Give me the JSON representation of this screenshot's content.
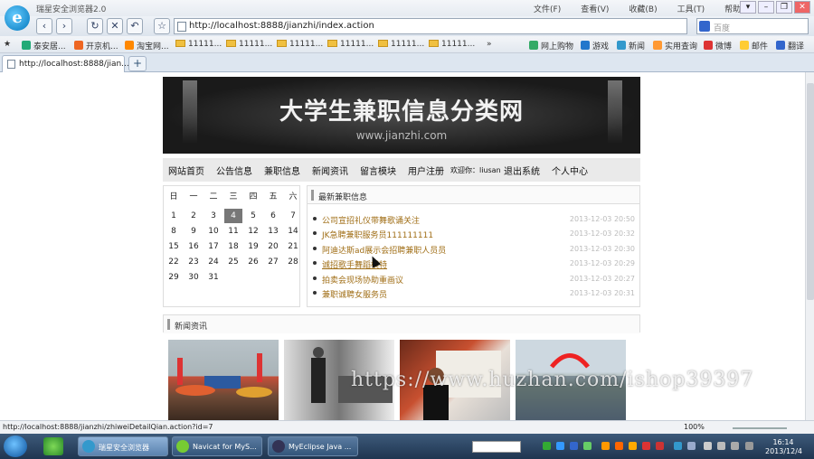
{
  "browser": {
    "title": "瑞星安全浏览器2.0",
    "menu": [
      "文件(F)",
      "查看(V)",
      "收藏(B)",
      "工具(T)",
      "帮助(H)"
    ],
    "address": "http://localhost:8888/jianzhi/index.action",
    "search_placeholder": "百度",
    "favorites": [
      "泰安居...",
      "开京机...",
      "淘宝网...",
      "11111...",
      "11111...",
      "11111...",
      "11111...",
      "11111...",
      "11111..."
    ],
    "favorites_right": [
      "网上购物",
      "游戏",
      "新闻",
      "实用查询",
      "微博",
      "邮件",
      "翻译"
    ],
    "more_chevron": "»",
    "tab_label": "http://localhost:8888/jian...",
    "new_tab": "+"
  },
  "page": {
    "banner_title": "大学生兼职信息分类网",
    "banner_url": "www.jianzhi.com",
    "nav": [
      "网站首页",
      "公告信息",
      "兼职信息",
      "新闻资讯",
      "留言模块",
      "用户注册"
    ],
    "welcome": "欢迎你：liusan",
    "logout": "退出系统",
    "personal": "个人中心",
    "calendar": {
      "weekdays": [
        "日",
        "一",
        "二",
        "三",
        "四",
        "五",
        "六"
      ],
      "weeks": [
        [
          "",
          "1",
          "2",
          "3",
          "4",
          "5",
          "6",
          "7"
        ],
        [
          "",
          "8",
          "9",
          "10",
          "11",
          "12",
          "13",
          "14"
        ],
        [
          "",
          "15",
          "16",
          "17",
          "18",
          "19",
          "20",
          "21"
        ],
        [
          "",
          "22",
          "23",
          "24",
          "25",
          "26",
          "27",
          "28"
        ],
        [
          "",
          "29",
          "30",
          "31"
        ]
      ],
      "today": "4"
    },
    "latest_jobs_title": "最新兼职信息",
    "jobs": [
      {
        "name": "公司宣招礼仪带舞歌诵关注",
        "time": "2013-12-03 20:50"
      },
      {
        "name": "JK急聘兼职服务员111111111",
        "time": "2013-12-03 20:32"
      },
      {
        "name": "阿迪达斯ad展示会招聘兼职人员员",
        "time": "2013-12-03 20:30"
      },
      {
        "name": "诚招歌手舞蹈模特",
        "time": "2013-12-03 20:29"
      },
      {
        "name": "拍卖会现场协助重画议",
        "time": "2013-12-03 20:27"
      },
      {
        "name": "兼职诚聘女服务员",
        "time": "2013-12-03 20:31"
      }
    ],
    "news_title": "新闻资讯",
    "photo_icons": [
      "photo-crowd-icon",
      "photo-suit-icon",
      "photo-speaker-icon",
      "photo-stadium-icon"
    ]
  },
  "watermark": "https://www.huzhan.com/ishop39397",
  "status": {
    "url": "http://localhost:8888/jianzhi/zhiweiDetailQian.action?id=7",
    "zoom": "100%"
  },
  "taskbar": {
    "tasks": [
      "瑞星安全浏览器",
      "Navicat for MyS...",
      "MyEclipse Java ..."
    ],
    "time": "16:14",
    "date": "2013/12/4"
  }
}
